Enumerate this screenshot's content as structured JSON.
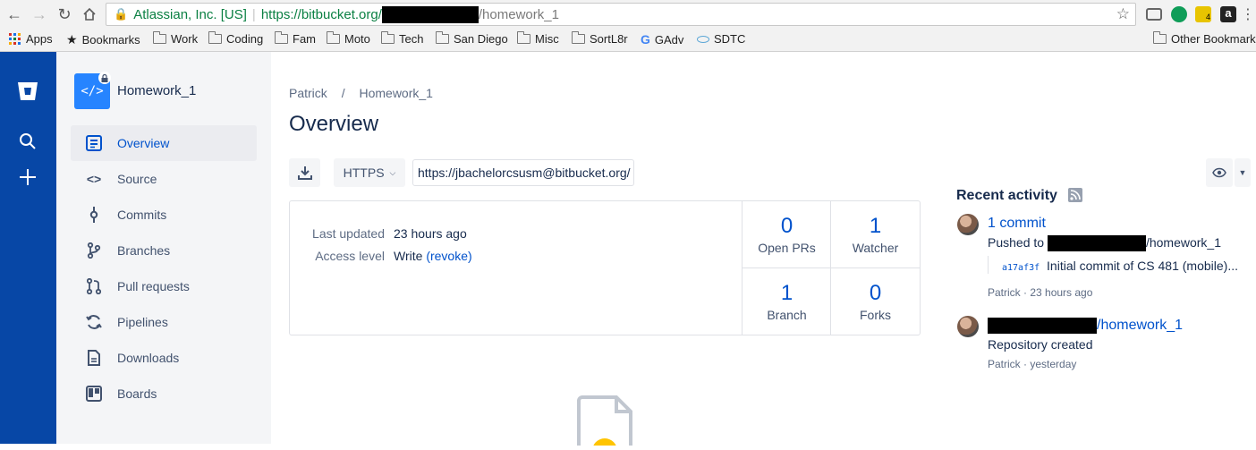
{
  "browser": {
    "secure_label": "Atlassian, Inc. [US]",
    "url_scheme_host": "https://bitbucket.org/",
    "url_path": "/homework_1",
    "bookmarks": [
      {
        "label": "Apps",
        "icon": "apps-grid-icon"
      },
      {
        "label": "Bookmarks",
        "icon": "star-icon"
      },
      {
        "label": "Work",
        "icon": "folder-icon"
      },
      {
        "label": "Coding",
        "icon": "folder-icon"
      },
      {
        "label": "Fam",
        "icon": "folder-icon"
      },
      {
        "label": "Moto",
        "icon": "folder-icon"
      },
      {
        "label": "Tech",
        "icon": "folder-icon"
      },
      {
        "label": "San Diego",
        "icon": "folder-icon"
      },
      {
        "label": "Misc",
        "icon": "folder-icon"
      },
      {
        "label": "SortL8r",
        "icon": "folder-icon"
      },
      {
        "label": "GAdv",
        "icon": "google-icon"
      },
      {
        "label": "SDTC",
        "icon": "sdtc-icon"
      }
    ],
    "other_bookmarks": "Other Bookmarks",
    "extension_badge": "4"
  },
  "sidebar": {
    "repo_name": "Homework_1",
    "items": [
      {
        "label": "Overview",
        "icon": "overview-icon",
        "active": true
      },
      {
        "label": "Source",
        "icon": "source-code-icon"
      },
      {
        "label": "Commits",
        "icon": "commit-icon"
      },
      {
        "label": "Branches",
        "icon": "branch-icon"
      },
      {
        "label": "Pull requests",
        "icon": "pull-request-icon"
      },
      {
        "label": "Pipelines",
        "icon": "pipelines-icon"
      },
      {
        "label": "Downloads",
        "icon": "document-icon"
      },
      {
        "label": "Boards",
        "icon": "board-icon"
      }
    ]
  },
  "main": {
    "breadcrumb": {
      "owner": "Patrick",
      "separator": "/",
      "repo": "Homework_1"
    },
    "title": "Overview",
    "clone": {
      "protocol": "HTTPS",
      "url": "https://jbachelorcsusm@bitbucket.org/"
    },
    "info": {
      "last_updated_label": "Last updated",
      "last_updated_value": "23 hours ago",
      "access_label": "Access level",
      "access_value": "Write",
      "revoke": "(revoke)"
    },
    "stats": [
      {
        "number": "0",
        "label": "Open PRs"
      },
      {
        "number": "1",
        "label": "Watcher"
      },
      {
        "number": "1",
        "label": "Branch"
      },
      {
        "number": "0",
        "label": "Forks"
      }
    ]
  },
  "activity": {
    "heading": "Recent activity",
    "items": [
      {
        "title": "1 commit",
        "pushed_to": "Pushed to",
        "repo_suffix": "/homework_1",
        "commit_hash": "a17af3f",
        "commit_msg": "Initial commit of CS 481 (mobile)...",
        "meta": "Patrick · 23 hours ago"
      },
      {
        "title_suffix": "/homework_1",
        "desc": "Repository created",
        "meta": "Patrick · yesterday"
      }
    ]
  },
  "colors": {
    "global_nav": "#0747a6",
    "link": "#0052cc",
    "sidebar_bg": "#f4f5f7"
  }
}
